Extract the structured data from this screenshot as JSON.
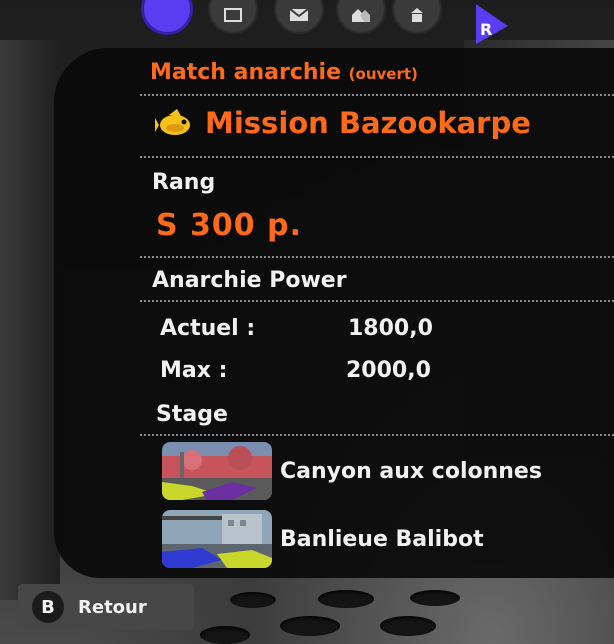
{
  "top_nav": {
    "icons": [
      "map-icon",
      "mail-icon",
      "friends-icon",
      "shop-icon"
    ],
    "right_tag": "R"
  },
  "match": {
    "mode": "Match anarchie",
    "mode_state": "(ouvert)",
    "mission_name": "Mission Bazookarpe"
  },
  "rank": {
    "label": "Rang",
    "value": "S 300 p."
  },
  "power": {
    "label": "Anarchie Power",
    "current_label": "Actuel :",
    "current_value": "1800,0",
    "max_label": "Max :",
    "max_value": "2000,0"
  },
  "stage": {
    "label": "Stage",
    "items": [
      {
        "name": "Canyon aux colonnes"
      },
      {
        "name": "Banlieue Balibot"
      }
    ]
  },
  "back_button": {
    "key": "B",
    "label": "Retour"
  },
  "colors": {
    "accent": "#ff6a1a",
    "panel": "#0a0a0a",
    "active_tab": "#5a3df0"
  }
}
